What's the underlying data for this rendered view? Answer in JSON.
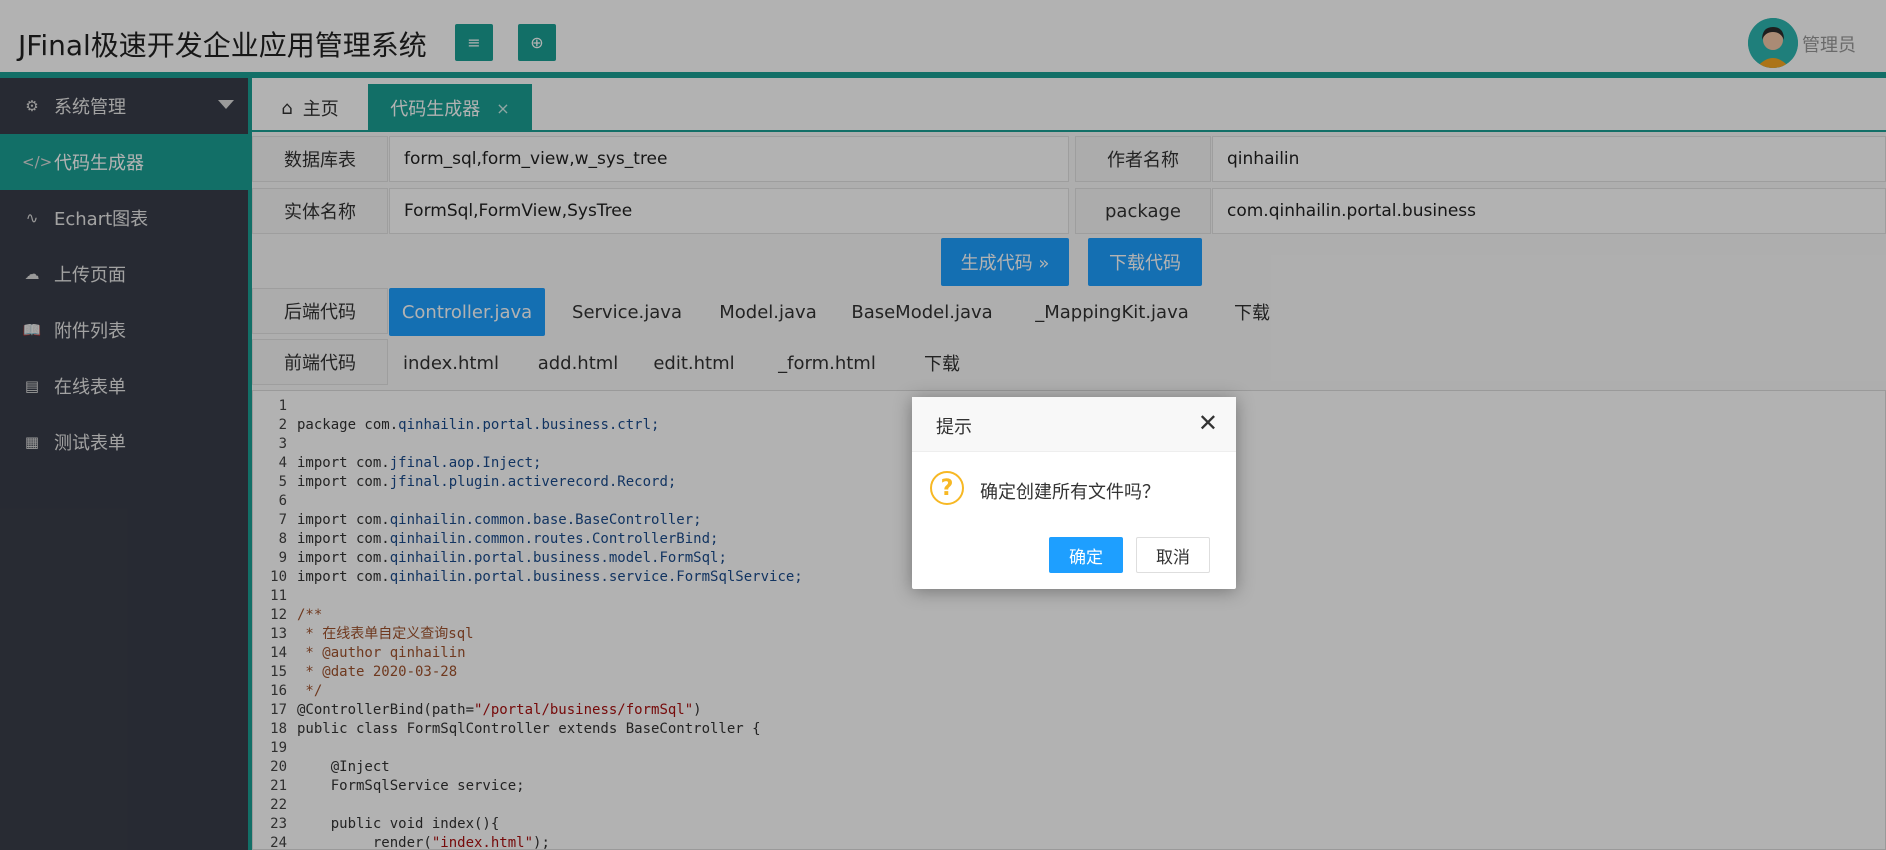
{
  "header": {
    "app_title": "JFinal极速开发企业应用管理系统",
    "menu_icon": "menu-icon",
    "globe_icon": "globe-icon",
    "user_name": "管理员"
  },
  "sidebar": {
    "items": [
      {
        "label": "系统管理",
        "icon": "gear-icon"
      },
      {
        "label": "代码生成器",
        "icon": "code-icon"
      },
      {
        "label": "Echart图表",
        "icon": "chart-pulse-icon"
      },
      {
        "label": "上传页面",
        "icon": "cloud-upload-icon"
      },
      {
        "label": "附件列表",
        "icon": "book-icon"
      },
      {
        "label": "在线表单",
        "icon": "form-icon"
      },
      {
        "label": "测试表单",
        "icon": "table-icon"
      }
    ]
  },
  "tabs": {
    "home": "主页",
    "active": "代码生成器",
    "close_glyph": "×"
  },
  "form": {
    "db_table_label": "数据库表",
    "db_table_value": "form_sql,form_view,w_sys_tree",
    "author_label": "作者名称",
    "author_value": "qinhailin",
    "entity_label": "实体名称",
    "entity_value": "FormSql,FormView,SysTree",
    "package_label": "package",
    "package_value": "com.qinhailin.portal.business",
    "generate_button": "生成代码 »",
    "download_button": "下载代码"
  },
  "backend": {
    "label": "后端代码",
    "tabs": [
      "Controller.java",
      "Service.java",
      "Model.java",
      "BaseModel.java",
      "_MappingKit.java",
      "下载"
    ]
  },
  "frontend": {
    "label": "前端代码",
    "tabs": [
      "index.html",
      "add.html",
      "edit.html",
      "_form.html",
      "下载"
    ]
  },
  "code": {
    "line_numbers": [
      "1",
      "2",
      "3",
      "4",
      "5",
      "6",
      "7",
      "8",
      "9",
      "10",
      "11",
      "12",
      "13",
      "14",
      "15",
      "16",
      "17",
      "18",
      "19",
      "20",
      "21",
      "22",
      "23",
      "24"
    ],
    "lines": [
      "",
      "package com.qinhailin.portal.business.ctrl;",
      "",
      "import com.jfinal.aop.Inject;",
      "import com.jfinal.plugin.activerecord.Record;",
      "",
      "import com.qinhailin.common.base.BaseController;",
      "import com.qinhailin.common.routes.ControllerBind;",
      "import com.qinhailin.portal.business.model.FormSql;",
      "import com.qinhailin.portal.business.service.FormSqlService;",
      "",
      "/**",
      " * 在线表单自定义查询sql",
      " * @author qinhailin",
      " * @date 2020-03-28",
      " */",
      "@ControllerBind(path=\"/portal/business/formSql\")",
      "public class FormSqlController extends BaseController {",
      "",
      "    @Inject",
      "    FormSqlService service;",
      "",
      "    public void index(){",
      "         render(\"index.html\");"
    ]
  },
  "dialog": {
    "title": "提示",
    "close_glyph": "✕",
    "icon_glyph": "?",
    "message": "确定创建所有文件吗？",
    "ok": "确定",
    "cancel": "取消"
  }
}
